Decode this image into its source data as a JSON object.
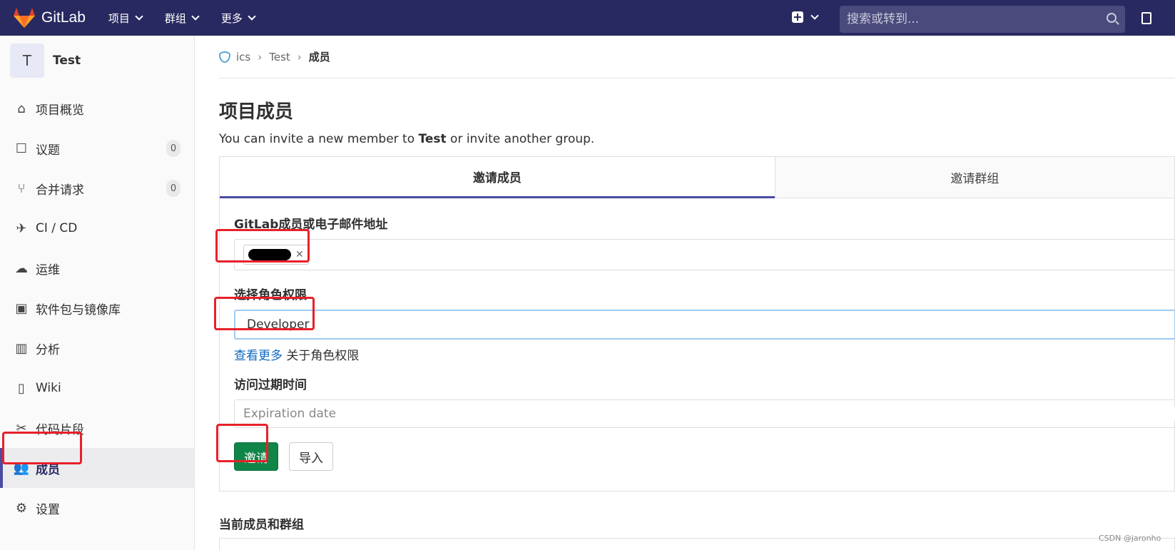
{
  "topbar": {
    "brand": "GitLab",
    "nav": [
      "项目",
      "群组",
      "更多"
    ],
    "search_placeholder": "搜索或转到..."
  },
  "sidebar": {
    "project_initial": "T",
    "project_name": "Test",
    "items": [
      {
        "label": "项目概览",
        "icon": "home-icon"
      },
      {
        "label": "议题",
        "icon": "issues-icon",
        "badge": "0"
      },
      {
        "label": "合并请求",
        "icon": "merge-request-icon",
        "badge": "0"
      },
      {
        "label": "CI / CD",
        "icon": "rocket-icon"
      },
      {
        "label": "运维",
        "icon": "cloud-gear-icon"
      },
      {
        "label": "软件包与镜像库",
        "icon": "package-icon"
      },
      {
        "label": "分析",
        "icon": "chart-icon"
      },
      {
        "label": "Wiki",
        "icon": "book-icon"
      },
      {
        "label": "代码片段",
        "icon": "scissors-icon"
      },
      {
        "label": "成员",
        "icon": "users-icon",
        "active": true
      },
      {
        "label": "设置",
        "icon": "gear-icon"
      }
    ]
  },
  "breadcrumb": [
    "ics",
    "Test",
    "成员"
  ],
  "page": {
    "title": "项目成员",
    "desc_prefix": "You can invite a new member to ",
    "desc_bold": "Test",
    "desc_suffix": " or invite another group."
  },
  "tabs": {
    "invite_member": "邀请成员",
    "invite_group": "邀请群组"
  },
  "form": {
    "member_label": "GitLab成员或电子邮件地址",
    "role_label": "选择角色权限",
    "role_value": "Developer",
    "help_link": "查看更多",
    "help_suffix": " 关于角色权限",
    "expiry_label": "访问过期时间",
    "expiry_placeholder": "Expiration date",
    "invite_button": "邀请",
    "import_button": "导入"
  },
  "current_members_heading": "当前成员和群组",
  "watermark": "CSDN @jaronho",
  "colors": {
    "navbar": "#292961",
    "primary_button": "#108548",
    "highlight_box": "#e8202a",
    "active_tab_underline": "#4b4ba3"
  }
}
